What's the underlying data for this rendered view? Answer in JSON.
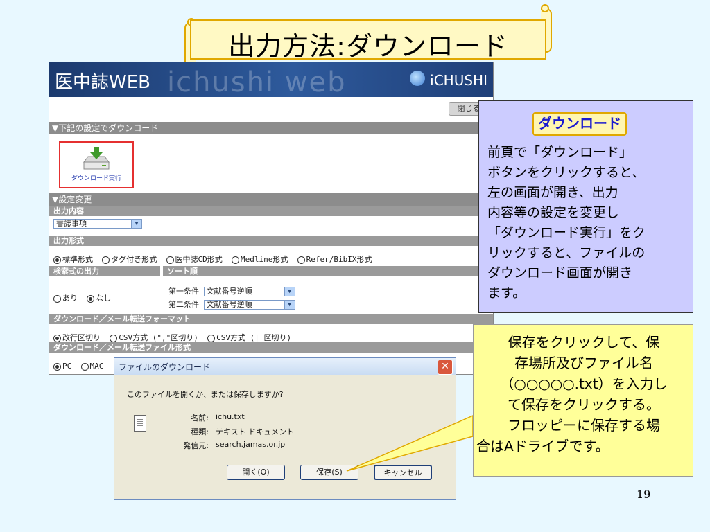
{
  "slide": {
    "title": "出力方法:ダウンロード",
    "page_number": "19"
  },
  "app": {
    "logo_text": "医中誌WEB",
    "watermark_text": "ichushi web",
    "brand_text": "iCHUSHI",
    "close_label": "閉じる",
    "sections": {
      "download_settings": "▼下記の設定でダウンロード",
      "change_settings": "▼設定変更",
      "output_content": "出力内容",
      "output_format": "出力形式",
      "search_output": "検索式の出力",
      "sort_order": "ソート順",
      "mail_format": "ダウンロード／メール転送フォーマット",
      "file_format": "ダウンロード／メール転送ファイル形式"
    },
    "download_exec_label": "ダウンロード実行",
    "output_content_value": "書誌事項",
    "format_options": [
      "標準形式",
      "タグ付き形式",
      "医中誌CD形式",
      "Medline形式",
      "Refer/BibIX形式"
    ],
    "search_output_options": [
      "あり",
      "なし"
    ],
    "sort_labels": [
      "第一条件",
      "第二条件"
    ],
    "sort_values": [
      "文献番号逆順",
      "文献番号逆順"
    ],
    "mail_format_options": [
      "改行区切り",
      "CSV方式 (\",\"区切り)",
      "CSV方式 (| 区切り)"
    ],
    "file_format_options": [
      "PC",
      "MAC"
    ]
  },
  "dialog": {
    "title": "ファイルのダウンロード",
    "question": "このファイルを開くか、または保存しますか?",
    "labels": {
      "name": "名前:",
      "type": "種類:",
      "from": "発信元:"
    },
    "values": {
      "name": "ichu.txt",
      "type": "テキスト ドキュメント",
      "from": "search.jamas.or.jp"
    },
    "buttons": {
      "open": "開く(O)",
      "save": "保存(S)",
      "cancel": "キャンセル"
    }
  },
  "notes": {
    "lavender": {
      "badge": "ダウンロード",
      "lines": [
        "前頁で「ダウンロード」",
        "ボタンをクリックすると、",
        "左の画面が開き、出力",
        "内容等の設定を変更し",
        "「ダウンロード実行」をク",
        "リックすると、ファイルの",
        "ダウンロード画面が開き",
        "ます。"
      ]
    },
    "yellow": {
      "lines": [
        "保存をクリックして、保",
        "存場所及びファイル名",
        "（○○○○○.txt）を入力し",
        "て保存をクリックする。",
        "フロッピーに保存する場",
        "合はAドライブです。"
      ]
    }
  },
  "colors": {
    "background": "#e8f8ff",
    "title_fill": "#fff9c4",
    "note_lavender": "#ccccff",
    "note_yellow": "#ffff99",
    "highlight_red": "#e53030",
    "app_header": "#2e5a9c"
  }
}
